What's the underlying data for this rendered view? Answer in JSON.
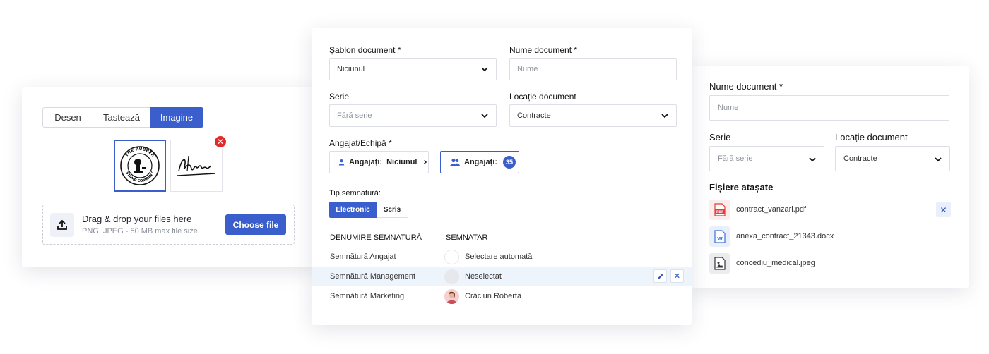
{
  "signature_panel": {
    "tabs": [
      "Desen",
      "Tastează",
      "Imagine"
    ],
    "active_tab": "Imagine",
    "stamp_text_top": "THE RUBBER",
    "stamp_text_bottom": "STAMP COMPANY",
    "upload": {
      "title": "Drag & drop your files here",
      "subtitle": "PNG, JPEG - 50 MB max file size.",
      "button": "Choose file"
    }
  },
  "document_form": {
    "template_label": "Șablon document *",
    "template_value": "Niciunul",
    "name_label": "Nume document *",
    "name_placeholder": "Nume",
    "series_label": "Serie",
    "series_value": "Fără serie",
    "location_label": "Locație document",
    "location_value": "Contracte",
    "employee_label": "Angajat/Echipă *",
    "employee_button_1": {
      "prefix": "Angajați:",
      "value": "Niciunul"
    },
    "employee_button_2": {
      "prefix": "Angajați:",
      "count": "35"
    },
    "signature_type_label": "Tip semnatură:",
    "signature_types": [
      "Electronic",
      "Scris"
    ],
    "table_headers": [
      "DENUMIRE SEMNATURĂ",
      "SEMNATAR"
    ],
    "signatures": [
      {
        "name": "Semnătură Angajat",
        "signer": "Selectare automată"
      },
      {
        "name": "Semnătură Management",
        "signer": "Neselectat"
      },
      {
        "name": "Semnătură Marketing",
        "signer": "Crăciun Roberta"
      }
    ]
  },
  "attachments_panel": {
    "name_label": "Nume document *",
    "name_placeholder": "Nume",
    "series_label": "Serie",
    "series_value": "Fără serie",
    "location_label": "Locație document",
    "location_value": "Contracte",
    "attachments_title": "Fișiere atașate",
    "files": [
      {
        "name": "contract_vanzari.pdf",
        "type": "pdf",
        "badge": "PDF"
      },
      {
        "name": "anexa_contract_21343.docx",
        "type": "docx",
        "badge": "W"
      },
      {
        "name": "concediu_medical.jpeg",
        "type": "image"
      }
    ]
  },
  "colors": {
    "accent": "#3a5fcd",
    "danger": "#e02b2b",
    "pdf": "#e23b3b",
    "highlight_row": "#eef4fc"
  }
}
